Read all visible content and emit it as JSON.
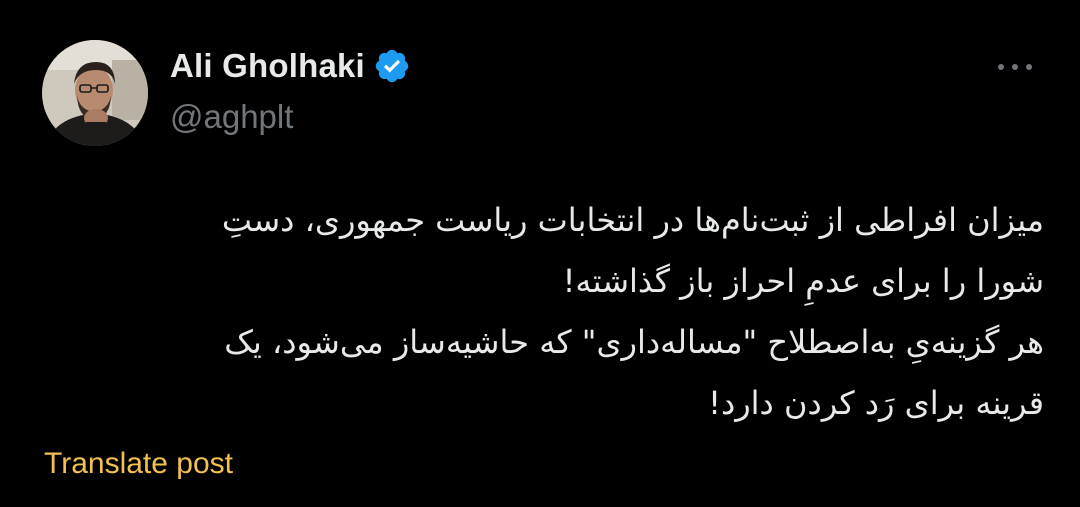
{
  "author": {
    "display_name": "Ali Gholhaki",
    "handle": "@aghplt",
    "verified": true
  },
  "tweet": {
    "lines": [
      "میزان افراطی از ثبت‌نام‌ها در انتخابات ریاست جمهوری، دستِ",
      "شورا را برای عدمِ احراز باز گذاشته!",
      "هر گزینه‌یِ به‌اصطلاح \"مساله‌داری\" که حاشیه‌ساز می‌شود، یک",
      "قرینه برای رَد کردن دارد!"
    ]
  },
  "actions": {
    "translate_label": "Translate post"
  },
  "icons": {
    "verified": "verified-badge-icon",
    "more": "more-options-icon"
  },
  "colors": {
    "background": "#000000",
    "text": "#e7e9ea",
    "secondary": "#71767b",
    "verified_blue": "#1d9bf0",
    "translate": "#f2c14e"
  }
}
